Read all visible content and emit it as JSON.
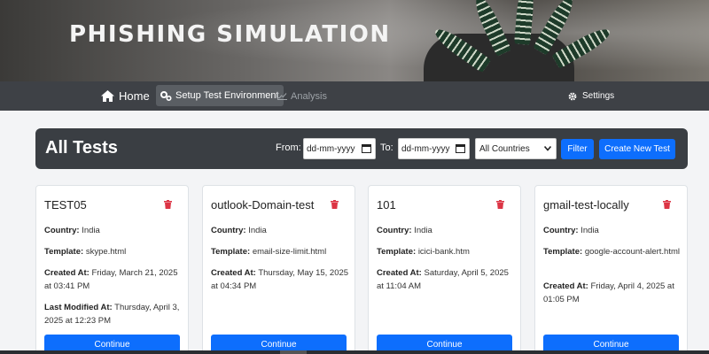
{
  "banner": {
    "title": "PHISHING SIMULATION"
  },
  "nav": {
    "home": {
      "label": "Home",
      "icon": "home-icon"
    },
    "setup": {
      "label": "Setup Test Environment",
      "icon": "gears-icon"
    },
    "analysis": {
      "label": "Analysis",
      "icon": "chart-line-icon"
    },
    "settings": {
      "label": "Settings",
      "icon": "gear-icon"
    }
  },
  "header": {
    "title": "All Tests",
    "from_label": "From:",
    "to_label": "To:",
    "from_value": "dd-mm-yyyy",
    "to_value": "dd-mm-yyyy",
    "country_selected": "All Countries",
    "filter_label": "Filter",
    "create_label": "Create New Test"
  },
  "colors": {
    "primary": "#0d6efd",
    "danger": "#dc3545",
    "nav_bg": "#3e4146",
    "header_bg": "#3a3e43"
  },
  "labels": {
    "country": "Country:",
    "template": "Template:",
    "created_at": "Created At:",
    "last_modified_at": "Last Modified At:",
    "continue": "Continue"
  },
  "tests": [
    {
      "name": "TEST05",
      "country": "India",
      "template": "skype.html",
      "created_at": "Friday, March 21, 2025 at 03:41 PM",
      "last_modified_at": "Thursday, April 3, 2025 at 12:23 PM"
    },
    {
      "name": "outlook-Domain-test",
      "country": "India",
      "template": "email-size-limit.html",
      "created_at": "Thursday, May 15, 2025 at 04:34 PM"
    },
    {
      "name": "101",
      "country": "India",
      "template": "icici-bank.htm",
      "created_at": "Saturday, April 5, 2025 at 11:04 AM"
    },
    {
      "name": "gmail-test-locally",
      "country": "India",
      "template": "google-account-alert.html",
      "created_at": "Friday, April 4, 2025 at 01:05 PM"
    }
  ]
}
